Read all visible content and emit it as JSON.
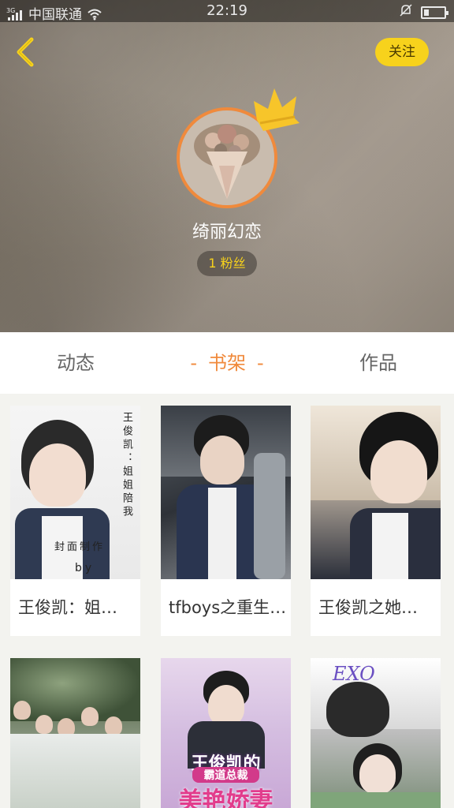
{
  "status_bar": {
    "network_label": "3G",
    "carrier": "中国联通",
    "time": "22:19",
    "icons": [
      "signal-icon",
      "wifi-icon",
      "mute-icon",
      "battery-icon"
    ]
  },
  "header": {
    "back_icon": "chevron-left-icon",
    "follow_label": "关注",
    "username": "绮丽幻恋",
    "fans_label": "1 粉丝",
    "colors": {
      "accent": "#f08a3c",
      "follow": "#f7d21c"
    }
  },
  "tabs": [
    {
      "label": "动态",
      "active": false
    },
    {
      "label": "书架",
      "active": true
    },
    {
      "label": "作品",
      "active": false
    }
  ],
  "books": [
    {
      "title": "王俊凯：姐…",
      "cover_text": "王俊凯：姐姐陪我",
      "cover_caption": "封面制作",
      "cover_by": "by"
    },
    {
      "title": "tfboys之重生…"
    },
    {
      "title": "王俊凯之她…"
    },
    {
      "title": ""
    },
    {
      "title": "",
      "cover_banner_1": "王俊凯的",
      "cover_banner_2": "霸道总裁",
      "cover_banner_3": "美艳娇妻"
    },
    {
      "title": "",
      "cover_banner_1": "EXO"
    }
  ]
}
